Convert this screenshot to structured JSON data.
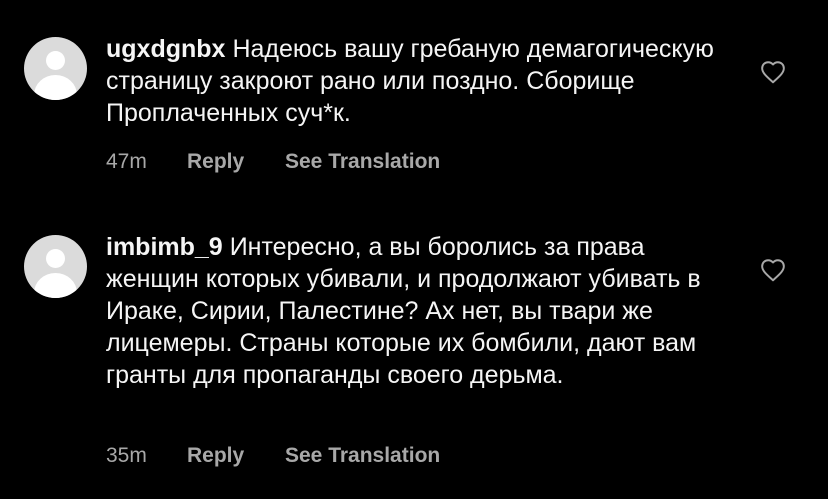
{
  "comments": [
    {
      "username": "ugxdgnbx",
      "text": "Надеюсь вашу гребаную демагогическую страницу закроют рано или поздно. Сборище Проплаченных суч*к.",
      "time": "47m",
      "reply_label": "Reply",
      "translate_label": "See Translation"
    },
    {
      "username": "imbimb_9",
      "text": "Интересно, а вы боролись за права женщин которых убивали, и продолжают убивать в Ираке, Сирии, Палестине? Ах нет, вы твари же лицемеры. Страны которые их бомбили, дают вам гранты для пропаганды своего дерьма.",
      "time": "35m",
      "reply_label": "Reply",
      "translate_label": "See Translation"
    }
  ],
  "icons": {
    "avatar": "default-avatar-icon",
    "like": "heart-outline-icon"
  },
  "colors": {
    "background": "#000000",
    "text": "#f5f5f5",
    "secondary_text": "#a8a8a8",
    "avatar_bg": "#dbdbdb"
  }
}
